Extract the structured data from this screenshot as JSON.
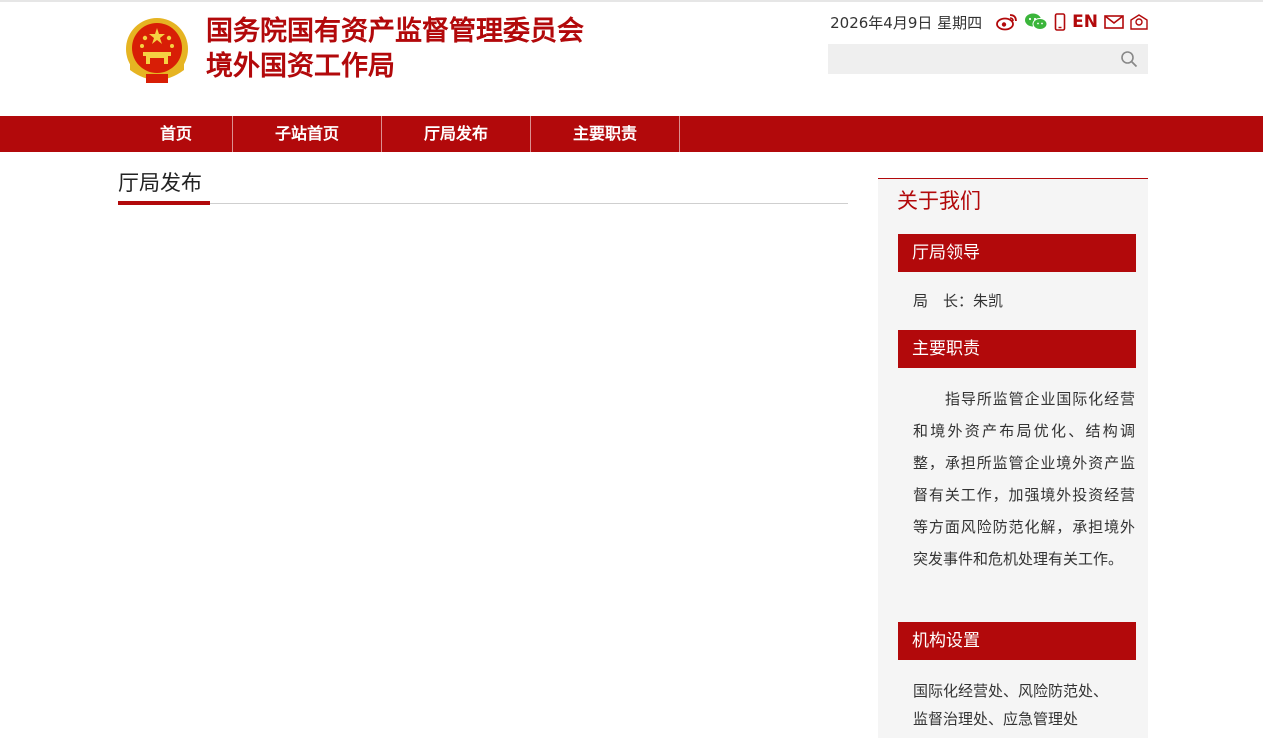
{
  "header": {
    "title_line1": "国务院国有资产监督管理委员会",
    "title_line2": "境外国资工作局",
    "date": "2026年4月9日 星期四",
    "en_label": "EN",
    "icons": [
      "weibo-icon",
      "wechat-icon",
      "mobile-icon",
      "mail-icon",
      "accessibility-icon"
    ],
    "search_placeholder": ""
  },
  "nav": {
    "items": [
      "首页",
      "子站首页",
      "厅局发布",
      "主要职责"
    ]
  },
  "main": {
    "section_title": "厅局发布"
  },
  "sidebar": {
    "title": "关于我们",
    "leadership": {
      "label": "厅局领导",
      "text": "局　长：朱凯"
    },
    "duties": {
      "label": "主要职责",
      "text": "指导所监管企业国际化经营和境外资产布局优化、结构调整，承担所监管企业境外资产监督有关工作，加强境外投资经营等方面风险防范化解，承担境外突发事件和危机处理有关工作。"
    },
    "structure": {
      "label": "机构设置",
      "line1": "国际化经营处、风险防范处、",
      "line2": "监督治理处、应急管理处"
    }
  },
  "colors": {
    "brand_red": "#b2090b",
    "sidebar_bg": "#f5f5f5",
    "emblem_gold": "#e6b422"
  }
}
